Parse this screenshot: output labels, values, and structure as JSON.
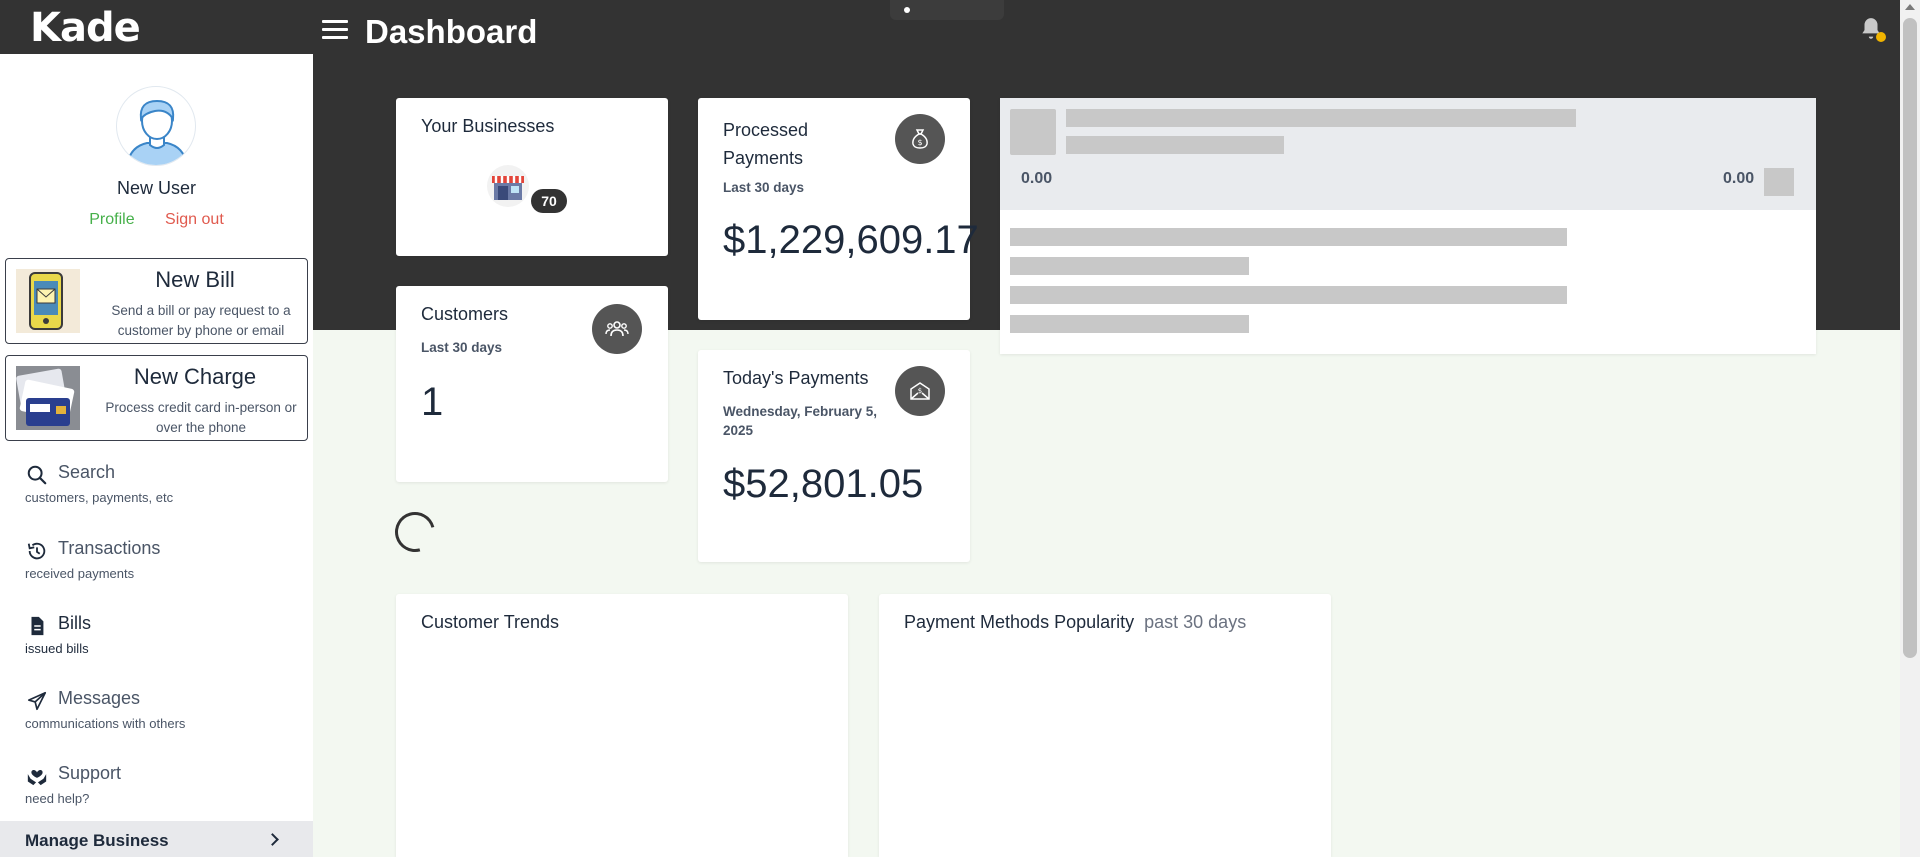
{
  "app": {
    "logo": "Kade",
    "title": "Dashboard"
  },
  "user": {
    "name": "New User",
    "profile_label": "Profile",
    "signout_label": "Sign out"
  },
  "actions": {
    "new_bill": {
      "title": "New Bill",
      "desc": "Send a bill or pay request to a customer by phone or email"
    },
    "new_charge": {
      "title": "New Charge",
      "desc": "Process credit card in-person or over the phone"
    }
  },
  "nav": [
    {
      "label": "Search",
      "sub": "customers, payments, etc",
      "icon": "search-icon"
    },
    {
      "label": "Transactions",
      "sub": "received payments",
      "icon": "history-icon"
    },
    {
      "label": "Bills",
      "sub": "issued bills",
      "icon": "document-icon"
    },
    {
      "label": "Messages",
      "sub": "communications with others",
      "icon": "paper-plane-icon"
    },
    {
      "label": "Support",
      "sub": "need help?",
      "icon": "hands-heart-icon"
    }
  ],
  "manage": {
    "label": "Manage Business"
  },
  "cards": {
    "businesses": {
      "title": "Your Businesses",
      "count": "70"
    },
    "processed": {
      "title": "Processed Payments",
      "period": "Last 30 days",
      "value": "$1,229,609.17"
    },
    "customers": {
      "title": "Customers",
      "period": "Last 30 days",
      "value": "1"
    },
    "today": {
      "title": "Today's Payments",
      "date": "Wednesday, February 5, 2025",
      "value": "$52,801.05"
    },
    "trends": {
      "title": "Customer Trends"
    },
    "methods": {
      "title": "Payment Methods Popularity",
      "period": "past 30 days"
    }
  },
  "skeleton": {
    "left_value": "0.00",
    "right_value": "0.00"
  },
  "colors": {
    "topbar": "#333333",
    "accent_green": "#46b04a",
    "accent_red": "#e05a4e",
    "badge_yellow": "#f1b400",
    "page_bg": "#f3f8f1"
  }
}
